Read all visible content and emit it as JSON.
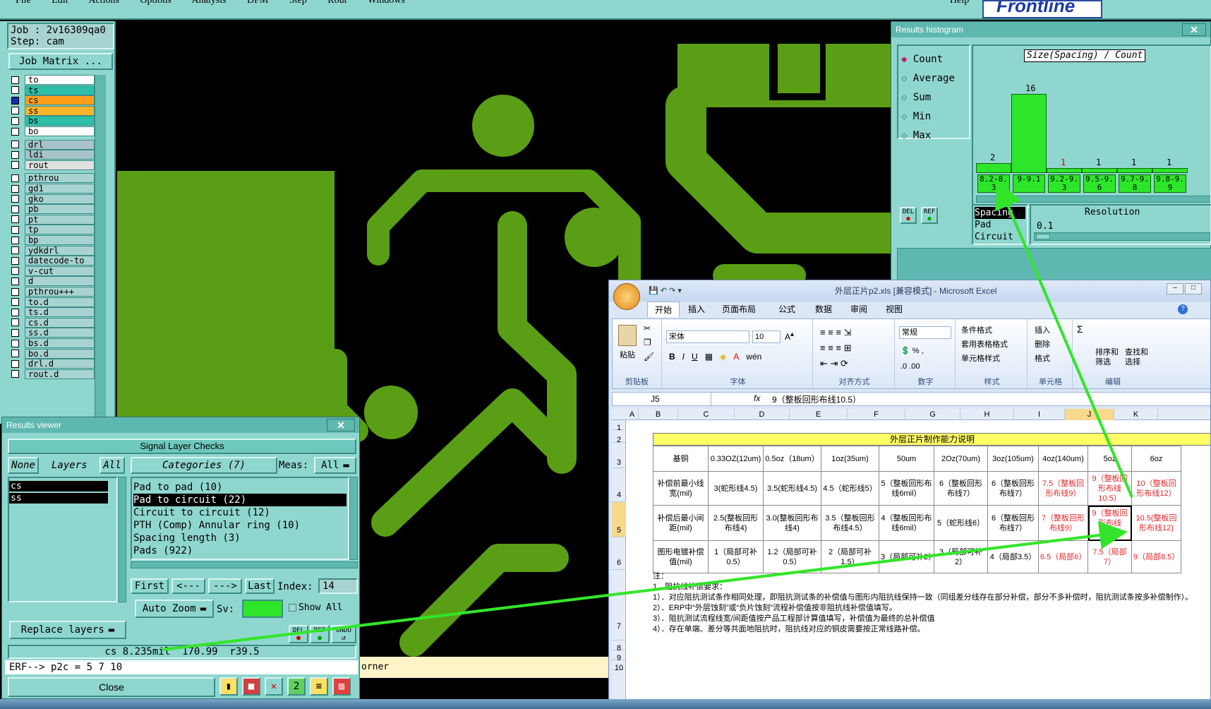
{
  "menu": [
    "File",
    "Edit",
    "Actions",
    "Options",
    "Analysis",
    "DFM",
    "Step",
    "Rout",
    "Windows"
  ],
  "menu_help": "Help",
  "brand": "Frontline",
  "job": {
    "job_label": "Job : 2v16309qa0",
    "step_label": "Step: cam",
    "matrix_button": "Job Matrix ..."
  },
  "layers": [
    "to",
    "ts",
    "cs",
    "ss",
    "bs",
    "bo",
    "drl",
    "ldi",
    "rout",
    "pthrou",
    "gd1",
    "gko",
    "pb",
    "pt",
    "tp",
    "bp",
    "ydkdrl",
    "datecode-to",
    "v-cut",
    "d",
    "pthrou+++",
    "to.d",
    "ts.d",
    "cs.d",
    "ss.d",
    "bs.d",
    "bo.d",
    "drl.d",
    "rout.d"
  ],
  "results_viewer": {
    "title": "Results viewer",
    "header": "Signal Layer Checks",
    "none_btn": "None",
    "layers_label": "Layers",
    "all_btn": "All",
    "categories_label": "Categories (7)",
    "meas_label": "Meas:",
    "meas_value": "All",
    "layer_list": [
      "cs",
      "ss"
    ],
    "categories": [
      "Pad to pad (10)",
      "Pad to circuit (22)",
      "Circuit to circuit (12)",
      "PTH (Comp) Annular ring (10)",
      "Spacing length (3)",
      "Pads (922)"
    ],
    "first_btn": "First",
    "prev_btn": "<---",
    "next_btn": "--->",
    "last_btn": "Last",
    "index_label": "Index:",
    "index_value": "14",
    "auto_zoom": "Auto Zoom",
    "sv_label": "Sv:",
    "show_all": "Show All",
    "replace_layers": "Replace layers",
    "del_btn": "DEL",
    "ref_btn": "REF",
    "undo_btn": "UNDO",
    "status_line": "cs 8.235mil  170.99  r39.5",
    "erf_line": "ERF--> p2c = 5 7 10",
    "close_btn": "Close",
    "corner_text": "orner"
  },
  "histogram": {
    "title": "Results histogram",
    "options": [
      "Count",
      "Average",
      "Sum",
      "Min",
      "Max"
    ],
    "chart_title": "Size(Spacing) / Count",
    "del_btn": "DEL",
    "ref_btn": "REF",
    "list": [
      "Spacing",
      "Pad",
      "Circuit"
    ],
    "resolution_label": "Resolution",
    "resolution_value": "0.1"
  },
  "chart_data": {
    "type": "bar",
    "title": "Size(Spacing) / Count",
    "categories": [
      "8.2-8.3",
      "9-9.1",
      "9.2-9.3",
      "9.5-9.6",
      "9.7-9.8",
      "9.8-9.9"
    ],
    "values": [
      2,
      16,
      1,
      1,
      1,
      1
    ],
    "label_colors": [
      "#000000",
      "#000000",
      "#d00000",
      "#000000",
      "#000000",
      "#000000"
    ],
    "ylim": [
      0,
      16
    ]
  },
  "excel": {
    "title": "外层正片p2.xls [兼容模式] - Microsoft Excel",
    "tabs": [
      "开始",
      "插入",
      "页面布局",
      "公式",
      "数据",
      "审阅",
      "视图"
    ],
    "groups": {
      "clipboard": "剪贴板",
      "font": "字体",
      "align": "对齐方式",
      "number": "数字",
      "styles": "样式",
      "cells": "单元格",
      "edit": "编辑"
    },
    "paste": "粘贴",
    "font_name": "宋体",
    "font_size": "10",
    "number_format": "常规",
    "styles_items": [
      "条件格式",
      "套用表格格式",
      "单元格样式"
    ],
    "cells_items": [
      "插入",
      "删除",
      "格式"
    ],
    "edit_items": [
      "排序和筛选",
      "查找和选择"
    ],
    "name_box": "J5",
    "formula": "9（整板回形布线10.5）",
    "col_headers": [
      "A",
      "B",
      "C",
      "D",
      "E",
      "F",
      "G",
      "H",
      "I",
      "J",
      "K"
    ],
    "row_headers": [
      "1",
      "2",
      "3",
      "4",
      "5",
      "6",
      "7",
      "8",
      "9",
      "10"
    ],
    "table_title": "外层正片制作能力说明",
    "header_row": [
      "基铜",
      "0.33OZ(12um)",
      "0.5oz（18um）",
      "1oz(35um)",
      "50um",
      "2Oz(70um)",
      "3oz(105um)",
      "4oz(140um)",
      "5oz",
      "6oz"
    ],
    "row4": [
      "补偿前最小线宽(mil)",
      "3(蛇形线4.5)",
      "3.5(蛇形线4.5)",
      "4.5（蛇形线5）",
      "5（整板回形布线6mil）",
      "6（整板回形布线7）",
      "6（整板回形布线7）",
      "7.5（整板回形布线9）",
      "9（整板回形布线10.5）",
      "10（整板回形布线12）"
    ],
    "row5": [
      "补偿后最小间距(mil)",
      "2.5(整板回形布线4)",
      "3.0(整板回形布线4)",
      "3.5（整板回形布线4.5）",
      "4（整板回形布线6mil）",
      "5（蛇形线6）",
      "6（整板回形布线7）",
      "7（整板回形布线9）",
      "9（整板回形布线10.5）",
      "10.5(整板回形布线12)"
    ],
    "row6": [
      "图形电镀补偿值(mil)",
      "1（局部可补0.5）",
      "1.2（局部可补0.5）",
      "2（局部可补1.5）",
      "3（局部可补2）",
      "3（局部可补2）",
      "4（局部3.5）",
      "6.5（局部6）",
      "7.5（局部7）",
      "9（局部8.5）"
    ],
    "notes": [
      "注：",
      "1、阻抗线补偿要求：",
      "1）．对应阻抗测试条作相同处理，即阻抗测试条的补偿值与图形内阻抗线保持一致（同组差分线存在部分补偿，部分不多补偿时，阻抗测试条按多补偿制作）。",
      "2）．ERP中“外层蚀刻”或“负片蚀刻”流程补偿值按非阻抗线补偿值填写。",
      "3）．阻抗测试流程线宽/间距值按产品工程部计算值填写，补偿值为最终的总补偿值",
      "4）．存在单端、差分等共面地阻抗时，阻抗线对应的铜皮需要按正常线路补偿。"
    ]
  }
}
